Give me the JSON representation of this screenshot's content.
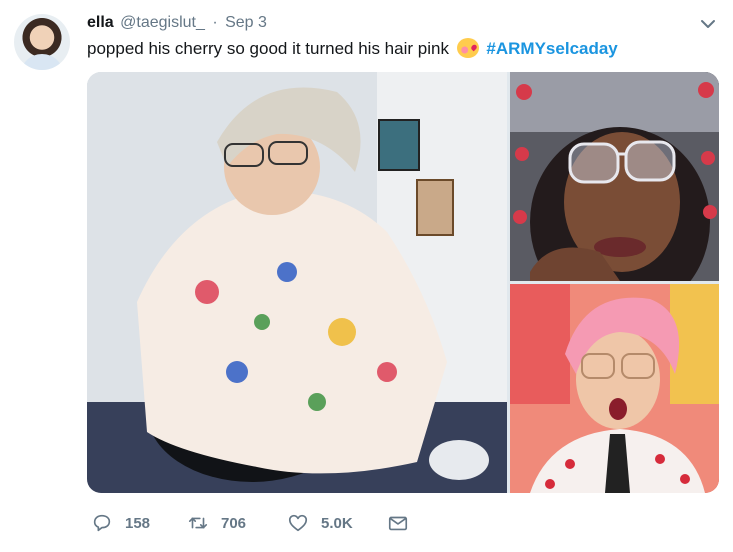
{
  "tweet": {
    "name": "ella",
    "handle": "@taegislut_",
    "separator": "·",
    "date": "Sep 3",
    "text_before": "popped his cherry so good it turned his hair pink",
    "hashtag": "#ARMYselcaday",
    "emoji_icon": "kissing-face-emoji-icon",
    "media": [
      {
        "name": "photo-man-floral-shirt"
      },
      {
        "name": "photo-selfie-glasses"
      },
      {
        "name": "photo-pink-hair-man"
      }
    ],
    "actions": {
      "reply_count": "158",
      "retweet_count": "706",
      "like_count": "5.0K"
    }
  },
  "colors": {
    "accent": "#1b95e0",
    "muted": "#657786",
    "text": "#14171a"
  }
}
